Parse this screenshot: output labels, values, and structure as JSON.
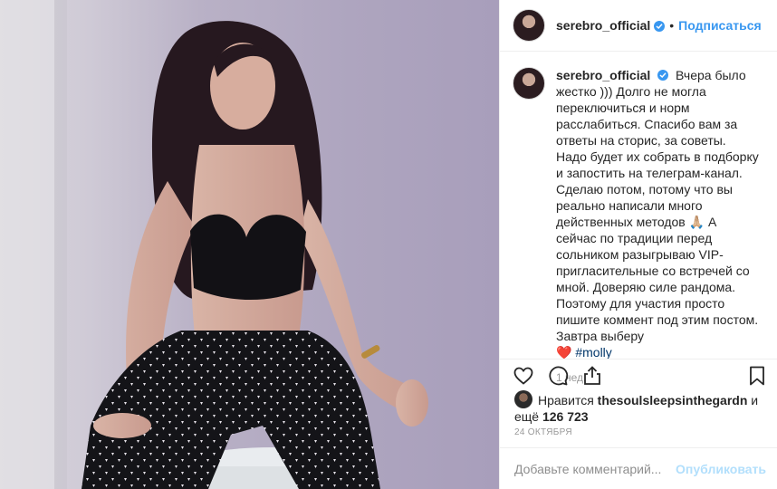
{
  "header": {
    "username": "serebro_official",
    "dot": "•",
    "follow_label": "Подписаться"
  },
  "caption": {
    "username": "serebro_official",
    "text": "Вчера было жестко ))) Долго не могла переключиться и норм расслабиться. Спасибо вам за ответы на сторис, за советы. Надо будет их собрать в подборку и запостить на телеграм-канал. Сделаю потом, потому что вы реально написали много действенных методов 🙏🏼 А сейчас по традиции перед сольником разыгрываю VIP-пригласительные со встречей со мной. Доверяю силе рандома. Поэтому для участия просто пишите коммент под этим постом. Завтра выберу",
    "heart": "❤️",
    "hashtag": "#molly",
    "time_ago": "1 нед."
  },
  "actions": {
    "like_icon": "heart-outline-icon",
    "comment_icon": "comment-icon",
    "share_icon": "share-icon",
    "save_icon": "bookmark-icon"
  },
  "likes": {
    "prefix": "Нравится",
    "liker": "thesoulsleepsinthegardn",
    "conj": "и",
    "more_prefix": "ещё",
    "more_count": "126 723"
  },
  "date": "24 ОКТЯБРЯ",
  "add_comment": {
    "placeholder": "Добавьте комментарий...",
    "publish_label": "Опубликовать"
  },
  "colors": {
    "accent": "#3897f0",
    "publish_disabled": "#b2dffc",
    "hashtag": "#003569",
    "muted": "#999999"
  }
}
